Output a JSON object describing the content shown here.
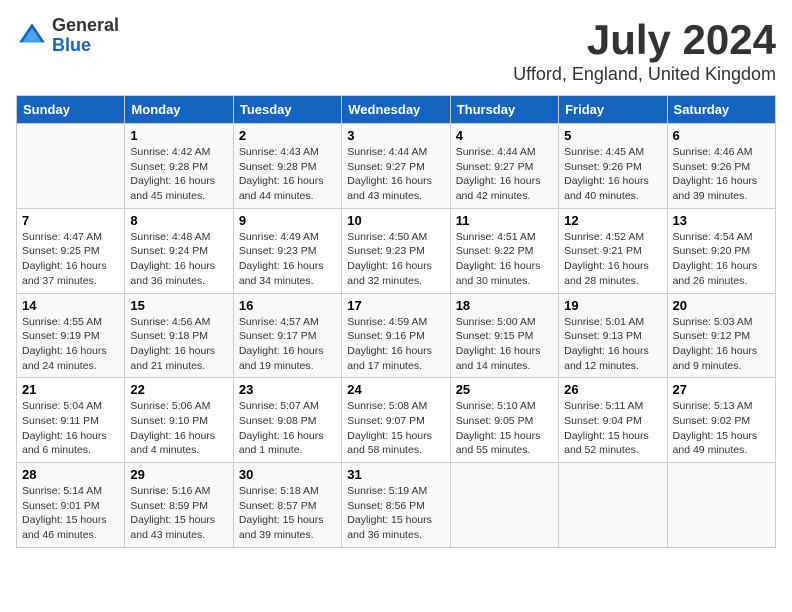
{
  "logo": {
    "general": "General",
    "blue": "Blue"
  },
  "title": {
    "month_year": "July 2024",
    "location": "Ufford, England, United Kingdom"
  },
  "headers": [
    "Sunday",
    "Monday",
    "Tuesday",
    "Wednesday",
    "Thursday",
    "Friday",
    "Saturday"
  ],
  "weeks": [
    [
      {
        "day": "",
        "info": ""
      },
      {
        "day": "1",
        "info": "Sunrise: 4:42 AM\nSunset: 9:28 PM\nDaylight: 16 hours\nand 45 minutes."
      },
      {
        "day": "2",
        "info": "Sunrise: 4:43 AM\nSunset: 9:28 PM\nDaylight: 16 hours\nand 44 minutes."
      },
      {
        "day": "3",
        "info": "Sunrise: 4:44 AM\nSunset: 9:27 PM\nDaylight: 16 hours\nand 43 minutes."
      },
      {
        "day": "4",
        "info": "Sunrise: 4:44 AM\nSunset: 9:27 PM\nDaylight: 16 hours\nand 42 minutes."
      },
      {
        "day": "5",
        "info": "Sunrise: 4:45 AM\nSunset: 9:26 PM\nDaylight: 16 hours\nand 40 minutes."
      },
      {
        "day": "6",
        "info": "Sunrise: 4:46 AM\nSunset: 9:26 PM\nDaylight: 16 hours\nand 39 minutes."
      }
    ],
    [
      {
        "day": "7",
        "info": "Sunrise: 4:47 AM\nSunset: 9:25 PM\nDaylight: 16 hours\nand 37 minutes."
      },
      {
        "day": "8",
        "info": "Sunrise: 4:48 AM\nSunset: 9:24 PM\nDaylight: 16 hours\nand 36 minutes."
      },
      {
        "day": "9",
        "info": "Sunrise: 4:49 AM\nSunset: 9:23 PM\nDaylight: 16 hours\nand 34 minutes."
      },
      {
        "day": "10",
        "info": "Sunrise: 4:50 AM\nSunset: 9:23 PM\nDaylight: 16 hours\nand 32 minutes."
      },
      {
        "day": "11",
        "info": "Sunrise: 4:51 AM\nSunset: 9:22 PM\nDaylight: 16 hours\nand 30 minutes."
      },
      {
        "day": "12",
        "info": "Sunrise: 4:52 AM\nSunset: 9:21 PM\nDaylight: 16 hours\nand 28 minutes."
      },
      {
        "day": "13",
        "info": "Sunrise: 4:54 AM\nSunset: 9:20 PM\nDaylight: 16 hours\nand 26 minutes."
      }
    ],
    [
      {
        "day": "14",
        "info": "Sunrise: 4:55 AM\nSunset: 9:19 PM\nDaylight: 16 hours\nand 24 minutes."
      },
      {
        "day": "15",
        "info": "Sunrise: 4:56 AM\nSunset: 9:18 PM\nDaylight: 16 hours\nand 21 minutes."
      },
      {
        "day": "16",
        "info": "Sunrise: 4:57 AM\nSunset: 9:17 PM\nDaylight: 16 hours\nand 19 minutes."
      },
      {
        "day": "17",
        "info": "Sunrise: 4:59 AM\nSunset: 9:16 PM\nDaylight: 16 hours\nand 17 minutes."
      },
      {
        "day": "18",
        "info": "Sunrise: 5:00 AM\nSunset: 9:15 PM\nDaylight: 16 hours\nand 14 minutes."
      },
      {
        "day": "19",
        "info": "Sunrise: 5:01 AM\nSunset: 9:13 PM\nDaylight: 16 hours\nand 12 minutes."
      },
      {
        "day": "20",
        "info": "Sunrise: 5:03 AM\nSunset: 9:12 PM\nDaylight: 16 hours\nand 9 minutes."
      }
    ],
    [
      {
        "day": "21",
        "info": "Sunrise: 5:04 AM\nSunset: 9:11 PM\nDaylight: 16 hours\nand 6 minutes."
      },
      {
        "day": "22",
        "info": "Sunrise: 5:06 AM\nSunset: 9:10 PM\nDaylight: 16 hours\nand 4 minutes."
      },
      {
        "day": "23",
        "info": "Sunrise: 5:07 AM\nSunset: 9:08 PM\nDaylight: 16 hours\nand 1 minute."
      },
      {
        "day": "24",
        "info": "Sunrise: 5:08 AM\nSunset: 9:07 PM\nDaylight: 15 hours\nand 58 minutes."
      },
      {
        "day": "25",
        "info": "Sunrise: 5:10 AM\nSunset: 9:05 PM\nDaylight: 15 hours\nand 55 minutes."
      },
      {
        "day": "26",
        "info": "Sunrise: 5:11 AM\nSunset: 9:04 PM\nDaylight: 15 hours\nand 52 minutes."
      },
      {
        "day": "27",
        "info": "Sunrise: 5:13 AM\nSunset: 9:02 PM\nDaylight: 15 hours\nand 49 minutes."
      }
    ],
    [
      {
        "day": "28",
        "info": "Sunrise: 5:14 AM\nSunset: 9:01 PM\nDaylight: 15 hours\nand 46 minutes."
      },
      {
        "day": "29",
        "info": "Sunrise: 5:16 AM\nSunset: 8:59 PM\nDaylight: 15 hours\nand 43 minutes."
      },
      {
        "day": "30",
        "info": "Sunrise: 5:18 AM\nSunset: 8:57 PM\nDaylight: 15 hours\nand 39 minutes."
      },
      {
        "day": "31",
        "info": "Sunrise: 5:19 AM\nSunset: 8:56 PM\nDaylight: 15 hours\nand 36 minutes."
      },
      {
        "day": "",
        "info": ""
      },
      {
        "day": "",
        "info": ""
      },
      {
        "day": "",
        "info": ""
      }
    ]
  ]
}
